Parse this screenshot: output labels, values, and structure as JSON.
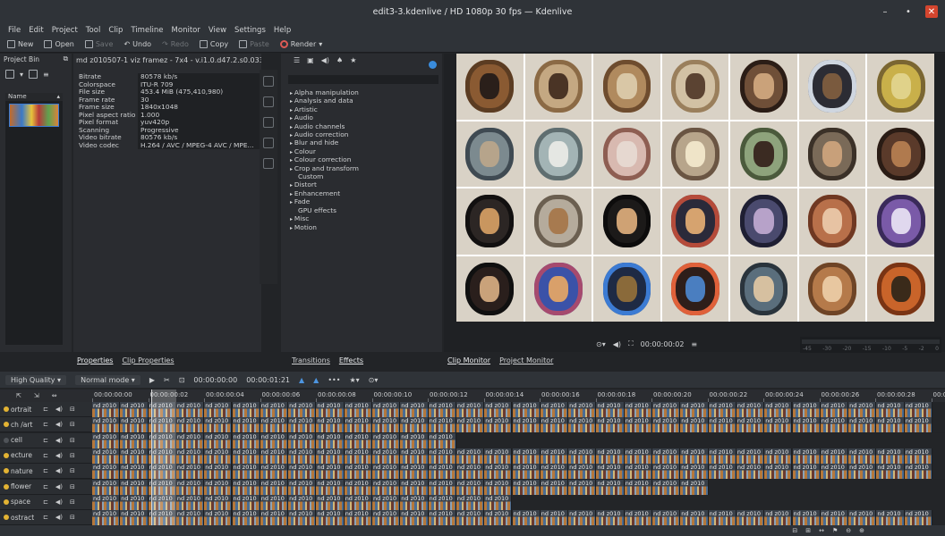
{
  "window": {
    "title": "edit3-3.kdenlive / HD 1080p 30 fps — Kdenlive",
    "controls": [
      "–",
      "•",
      "✕"
    ]
  },
  "menu": [
    "File",
    "Edit",
    "Project",
    "Tool",
    "Clip",
    "Timeline",
    "Monitor",
    "View",
    "Settings",
    "Help"
  ],
  "toolbar": {
    "new": "New",
    "open": "Open",
    "save": "Save",
    "undo": "Undo",
    "redo": "Redo",
    "copy": "Copy",
    "paste": "Paste",
    "render": "Render"
  },
  "bin": {
    "title": "Project Bin",
    "column_name": "Name"
  },
  "info": {
    "clip_name": "md z010507-1 viz framez - 7x4 - v.i1.0.d47.2.s0.03333.m0.z(2(",
    "rows": [
      {
        "k": "Bitrate",
        "v": "80578 kb/s"
      },
      {
        "k": "Colorspace",
        "v": "ITU-R 709"
      },
      {
        "k": "File size",
        "v": "453.4 MiB (475,410,980)"
      },
      {
        "k": "Frame rate",
        "v": "30"
      },
      {
        "k": "Frame size",
        "v": "1840x1048"
      },
      {
        "k": "Pixel aspect ratio",
        "v": "1.000"
      },
      {
        "k": "Pixel format",
        "v": "yuv420p"
      },
      {
        "k": "Scanning",
        "v": "Progressive"
      },
      {
        "k": "Video bitrate",
        "v": "80576 kb/s"
      },
      {
        "k": "Video codec",
        "v": "H.264 / AVC / MPEG-4 AVC / MPE..."
      }
    ]
  },
  "effects": {
    "items": [
      {
        "label": "Alpha manipulation",
        "leaf": false
      },
      {
        "label": "Analysis and data",
        "leaf": false
      },
      {
        "label": "Artistic",
        "leaf": false
      },
      {
        "label": "Audio",
        "leaf": false
      },
      {
        "label": "Audio channels",
        "leaf": false
      },
      {
        "label": "Audio correction",
        "leaf": false
      },
      {
        "label": "Blur and hide",
        "leaf": false
      },
      {
        "label": "Colour",
        "leaf": false
      },
      {
        "label": "Colour correction",
        "leaf": false
      },
      {
        "label": "Crop and transform",
        "leaf": false
      },
      {
        "label": "Custom",
        "leaf": true
      },
      {
        "label": "Distort",
        "leaf": false
      },
      {
        "label": "Enhancement",
        "leaf": false
      },
      {
        "label": "Fade",
        "leaf": false
      },
      {
        "label": "GPU effects",
        "leaf": true
      },
      {
        "label": "Misc",
        "leaf": false
      },
      {
        "label": "Motion",
        "leaf": false
      }
    ]
  },
  "tabs": {
    "left": [
      "Properties",
      "Clip Properties"
    ],
    "middle": [
      "Transitions",
      "Effects"
    ],
    "right": [
      "Clip Monitor",
      "Project Monitor"
    ]
  },
  "monitor": {
    "timecode": "00:00:00:02",
    "vu_labels": [
      "-45",
      "-30",
      "-20",
      "-15",
      "-10",
      "-5",
      "-2",
      "0"
    ]
  },
  "timeline_toolbar": {
    "quality": "High Quality",
    "mode": "Normal mode",
    "position": "00:00:00:00",
    "duration": "00:00:01:21"
  },
  "ruler": [
    "00:00:00:00",
    "00:00:00:02",
    "00:00:00:04",
    "00:00:00:06",
    "00:00:00:08",
    "00:00:00:10",
    "00:00:00:12",
    "00:00:00:14",
    "00:00:00:16",
    "00:00:00:18",
    "00:00:00:20",
    "00:00:00:22",
    "00:00:00:24",
    "00:00:00:26",
    "00:00:00:28",
    "00:00:"
  ],
  "tracks": [
    {
      "name": "ortrait",
      "active": true,
      "clips": 30
    },
    {
      "name": "ch /art",
      "active": true,
      "clips": 30
    },
    {
      "name": "cell",
      "active": false,
      "clips": 13
    },
    {
      "name": "ecture",
      "active": true,
      "clips": 30
    },
    {
      "name": "nature",
      "active": true,
      "clips": 30
    },
    {
      "name": "flower",
      "active": true,
      "clips": 22
    },
    {
      "name": "space",
      "active": true,
      "clips": 15
    },
    {
      "name": "ostract",
      "active": true,
      "clips": 30
    }
  ],
  "clip_label": "nd z010",
  "grid_cells": [
    {
      "c1": "#8a5a32",
      "c2": "#5b3c22",
      "c3": "#2a1f1a"
    },
    {
      "c1": "#c4a882",
      "c2": "#8b6a45",
      "c3": "#4a3425"
    },
    {
      "c1": "#b08a5e",
      "c2": "#6e4c2e",
      "c3": "#d9c7a6"
    },
    {
      "c1": "#d2c1a4",
      "c2": "#9a7f5c",
      "c3": "#5b4332"
    },
    {
      "c1": "#6f4f38",
      "c2": "#2b1d16",
      "c3": "#caa27a"
    },
    {
      "c1": "#2c2c34",
      "c2": "#cfd6e0",
      "c3": "#7a5a3e"
    },
    {
      "c1": "#c9b04a",
      "c2": "#7a6632",
      "c3": "#e0d28a"
    },
    {
      "c1": "#7c8a8f",
      "c2": "#3f4a52",
      "c3": "#b6a48b"
    },
    {
      "c1": "#a3b4b5",
      "c2": "#5f6e70",
      "c3": "#e5e7e3"
    },
    {
      "c1": "#d8b9b0",
      "c2": "#8e5e52",
      "c3": "#e6d8d0"
    },
    {
      "c1": "#b7a58b",
      "c2": "#6a5543",
      "c3": "#efe4c8"
    },
    {
      "c1": "#8ea37c",
      "c2": "#4b5a3c",
      "c3": "#3b2b22"
    },
    {
      "c1": "#7a6a58",
      "c2": "#3b3128",
      "c3": "#c8a07a"
    },
    {
      "c1": "#5a3a2a",
      "c2": "#2a1c15",
      "c3": "#b07a4e"
    },
    {
      "c1": "#2c2624",
      "c2": "#121010",
      "c3": "#c9965f"
    },
    {
      "c1": "#b5ab9c",
      "c2": "#6b5f50",
      "c3": "#a77a4f"
    },
    {
      "c1": "#1c1a19",
      "c2": "#0d0c0c",
      "c3": "#cfa274"
    },
    {
      "c1": "#2b2a3a",
      "c2": "#b54b3a",
      "c3": "#d6a36f"
    },
    {
      "c1": "#4a4a6e",
      "c2": "#1f1f33",
      "c3": "#b7a2c9"
    },
    {
      "c1": "#b8704a",
      "c2": "#6f3822",
      "c3": "#e7c3a3"
    },
    {
      "c1": "#7a5aa8",
      "c2": "#3a2a5a",
      "c3": "#e0d8ee"
    },
    {
      "c1": "#2a1f1c",
      "c2": "#101010",
      "c3": "#c9a27a"
    },
    {
      "c1": "#3b52a8",
      "c2": "#a64a6e",
      "c3": "#d9a06a"
    },
    {
      "c1": "#1e2a44",
      "c2": "#3c7bd3",
      "c3": "#8a6a3a"
    },
    {
      "c1": "#2e1e1a",
      "c2": "#e0613a",
      "c3": "#4a7ec0"
    },
    {
      "c1": "#5a6e7c",
      "c2": "#2a343c",
      "c3": "#d6c0a0"
    },
    {
      "c1": "#b57a4a",
      "c2": "#6e4426",
      "c3": "#e8c7a0"
    },
    {
      "c1": "#c9642a",
      "c2": "#7a3414",
      "c3": "#3a2a1a"
    }
  ]
}
